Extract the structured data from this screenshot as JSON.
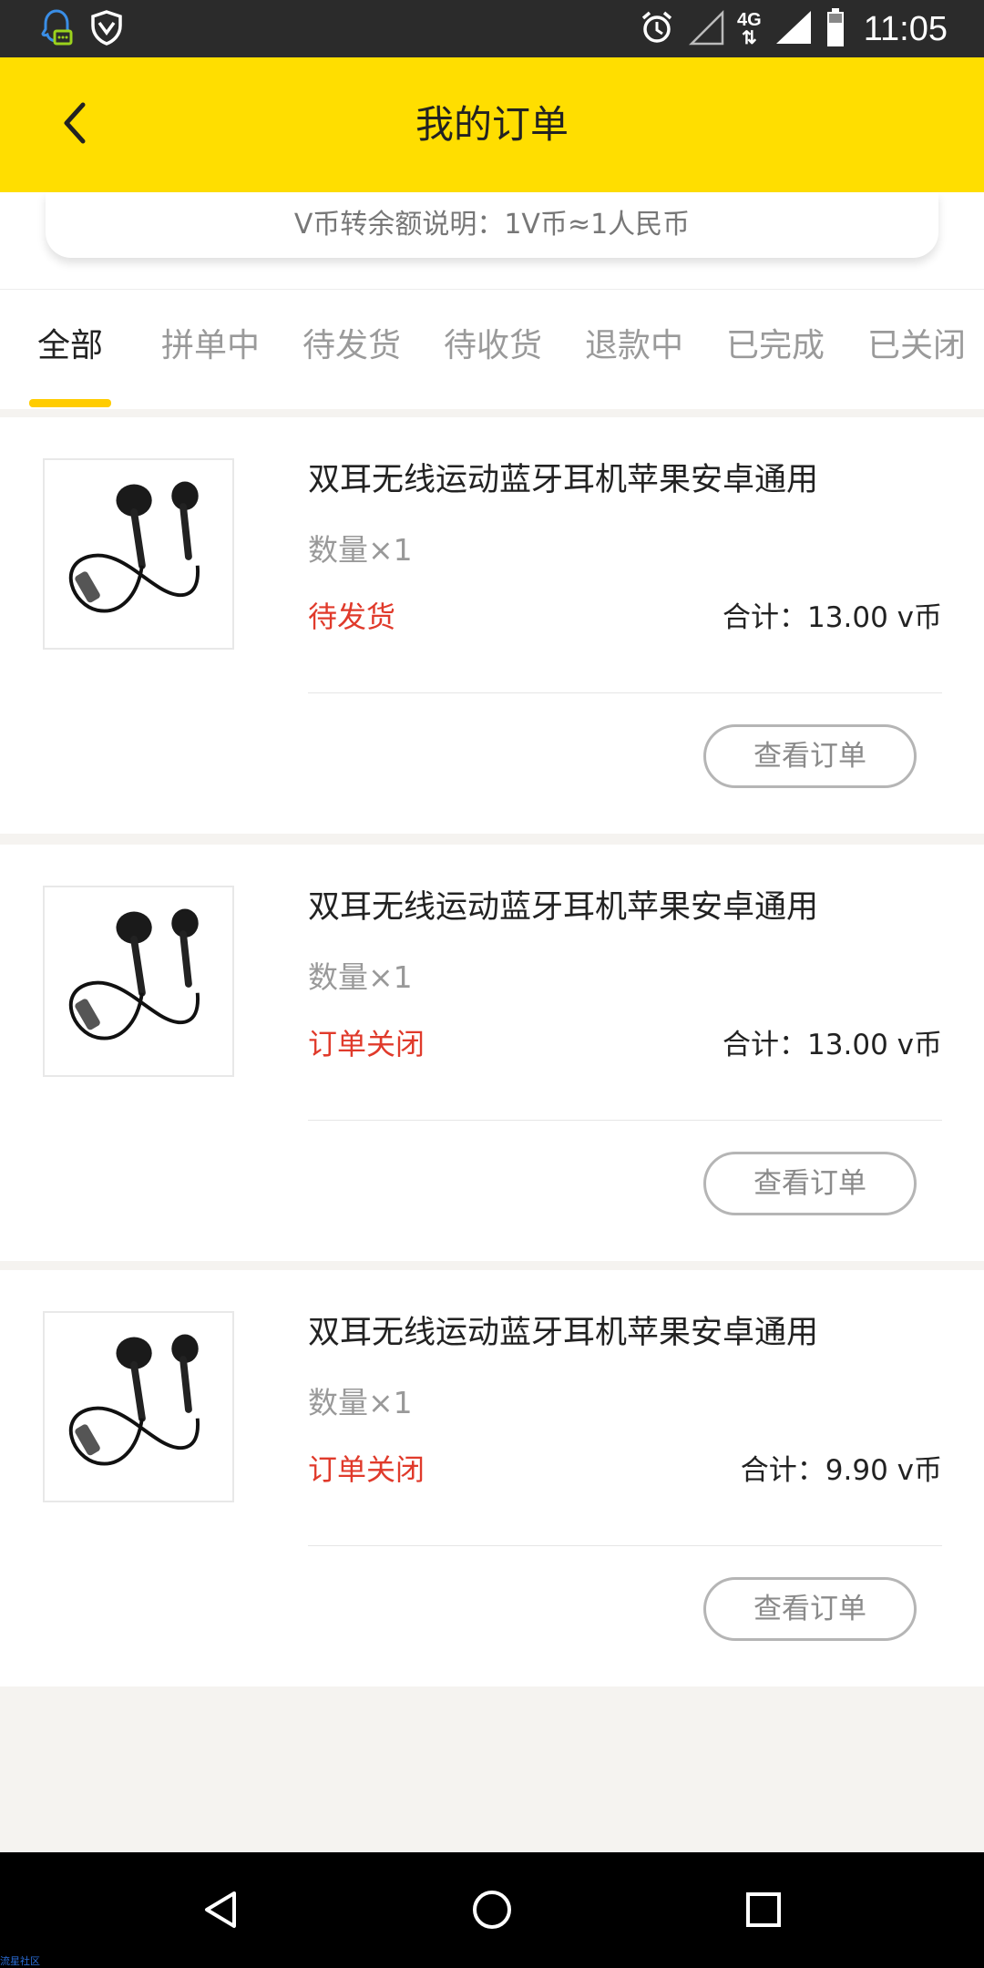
{
  "status_bar": {
    "time": "11:05",
    "network": "4G",
    "icons": [
      "qq-notification-icon",
      "shield-icon",
      "alarm-icon",
      "signal-icon",
      "network-4g-icon",
      "signal-full-icon",
      "battery-icon"
    ]
  },
  "header": {
    "title": "我的订单",
    "back_icon": "chevron-left-icon"
  },
  "info": {
    "text": "V币转余额说明：1V币≈1人民币"
  },
  "tabs": [
    {
      "label": "全部",
      "active": true
    },
    {
      "label": "拼单中",
      "active": false
    },
    {
      "label": "待发货",
      "active": false
    },
    {
      "label": "待收货",
      "active": false
    },
    {
      "label": "退款中",
      "active": false
    },
    {
      "label": "已完成",
      "active": false
    },
    {
      "label": "已关闭",
      "active": false
    }
  ],
  "orders": [
    {
      "title": "双耳无线运动蓝牙耳机苹果安卓通用",
      "quantity": "数量×1",
      "status": "待发货",
      "total": "合计：13.00 v币",
      "button": "查看订单"
    },
    {
      "title": "双耳无线运动蓝牙耳机苹果安卓通用",
      "quantity": "数量×1",
      "status": "订单关闭",
      "total": "合计：13.00 v币",
      "button": "查看订单"
    },
    {
      "title": "双耳无线运动蓝牙耳机苹果安卓通用",
      "quantity": "数量×1",
      "status": "订单关闭",
      "total": "合计：9.90 v币",
      "button": "查看订单"
    }
  ],
  "colors": {
    "accent": "#ffde00",
    "tab_indicator": "#ffcc00",
    "status_text": "#e03a2b",
    "background": "#f5f3f0"
  },
  "nav": {
    "icons": [
      "back-triangle-icon",
      "home-circle-icon",
      "recents-square-icon"
    ]
  },
  "watermark": "流星社区"
}
